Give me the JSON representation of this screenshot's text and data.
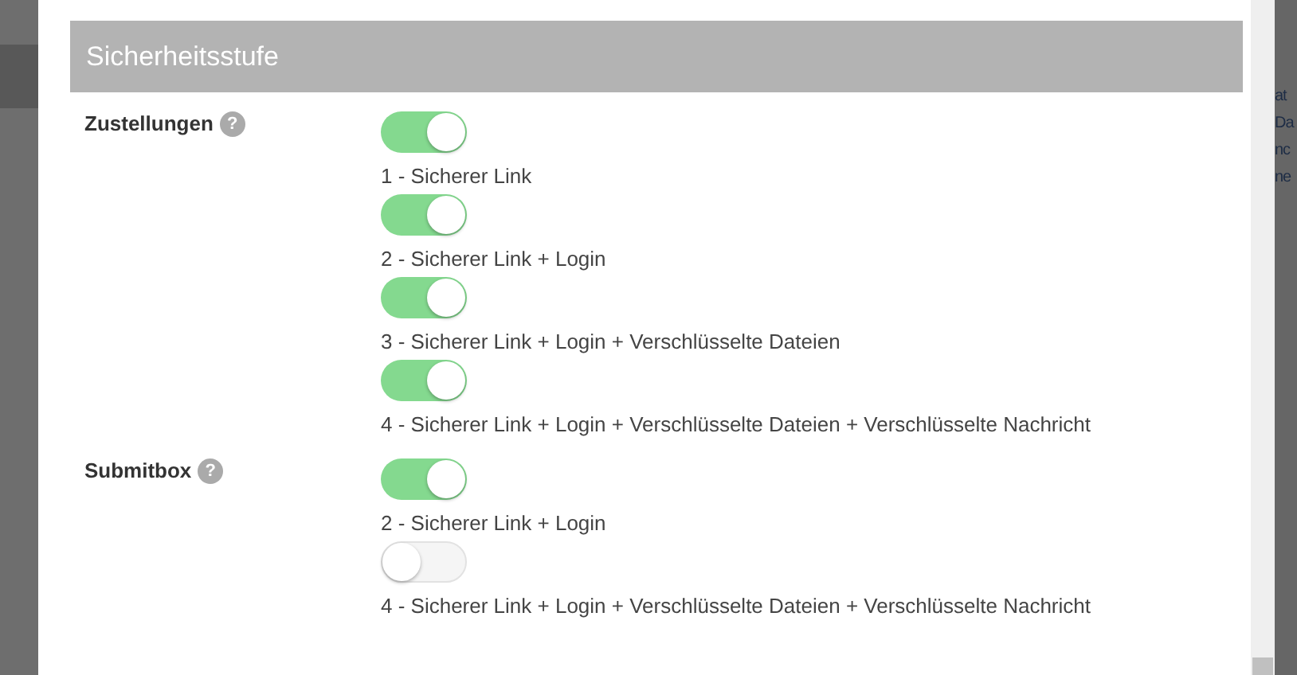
{
  "background_text": [
    "at",
    "Da",
    "nc",
    "ne"
  ],
  "section": {
    "title": "Sicherheitsstufe"
  },
  "groups": [
    {
      "label": "Zustellungen",
      "help": "?",
      "options": [
        {
          "label": "1 - Sicherer Link",
          "on": true
        },
        {
          "label": "2 - Sicherer Link + Login",
          "on": true
        },
        {
          "label": "3 - Sicherer Link + Login + Verschlüsselte Dateien",
          "on": true
        },
        {
          "label": "4 - Sicherer Link + Login + Verschlüsselte Dateien + Verschlüsselte Nachricht",
          "on": true
        }
      ]
    },
    {
      "label": "Submitbox",
      "help": "?",
      "options": [
        {
          "label": "2 - Sicherer Link + Login",
          "on": true
        },
        {
          "label": "4 - Sicherer Link + Login + Verschlüsselte Dateien + Verschlüsselte Nachricht",
          "on": false
        }
      ]
    }
  ]
}
